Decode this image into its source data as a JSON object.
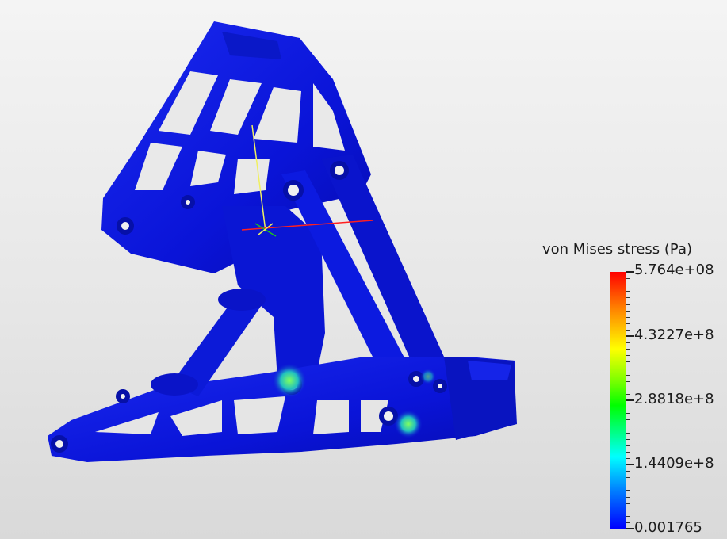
{
  "colorbar": {
    "title": "von Mises stress (Pa)",
    "labels": [
      "5.764e+08",
      "4.3227e+8",
      "2.8818e+8",
      "1.4409e+8",
      "0.001765"
    ],
    "colors": {
      "max": "#ff0000",
      "high": "#ffff00",
      "mid": "#00ff00",
      "low": "#00ffff",
      "min": "#0000ff"
    }
  },
  "scene": {
    "model_color": "#0a14e0",
    "axis_colors": {
      "x": "#ff2020",
      "y": "#f0f060",
      "z": "#20c020"
    }
  }
}
